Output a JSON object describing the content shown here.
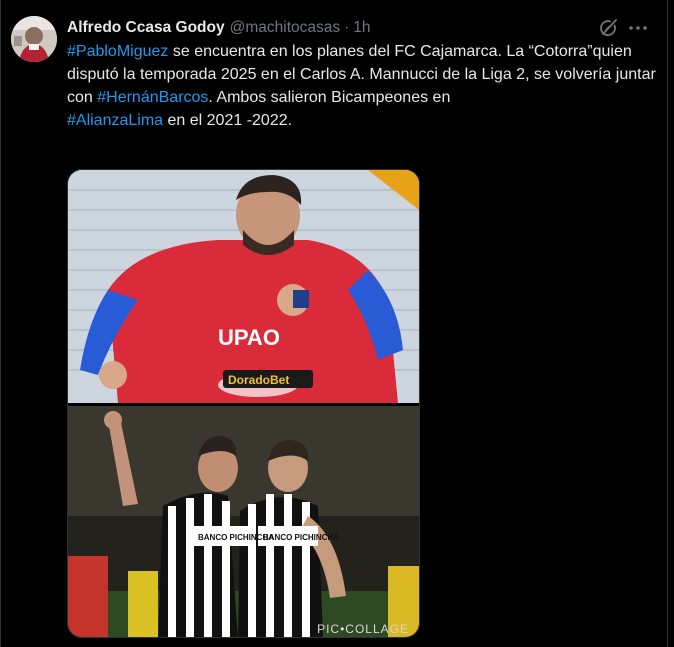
{
  "tweet": {
    "author_name": "Alfredo Ccasa Godoy",
    "author_handle": "@machitocasas",
    "separator": "·",
    "time": "1h",
    "text_segments": [
      {
        "text": "#PabloMiguez",
        "hashtag": true
      },
      {
        "text": " se encuentra en los planes del FC Cajamarca. La “Cotorra”quien disputó la temporada 2025 en el Carlos A. Mannucci de la Liga 2,  se volvería juntar con ",
        "hashtag": false
      },
      {
        "text": "#HernánBarcos",
        "hashtag": true
      },
      {
        "text": ". Ambos salieron Bicampeones en",
        "hashtag": false
      },
      {
        "text": "#AlianzaLima",
        "hashtag": true
      },
      {
        "text": " en el 2021 -2022.",
        "hashtag": false
      }
    ]
  },
  "media": {
    "top_photo": {
      "sponsor_chest": "UPAO",
      "sponsor_lower": "DoradoBet"
    },
    "bottom_photo": {
      "sponsor": "BANCO PICHINCHA",
      "watermark": "PIC•COLLAGE"
    }
  },
  "icons": {
    "grok": "grok-icon",
    "more": "more-options-icon"
  },
  "colors": {
    "background": "#000000",
    "text": "#e7e9ea",
    "muted": "#71767b",
    "link": "#1d9bf0",
    "border": "#2f3336"
  }
}
